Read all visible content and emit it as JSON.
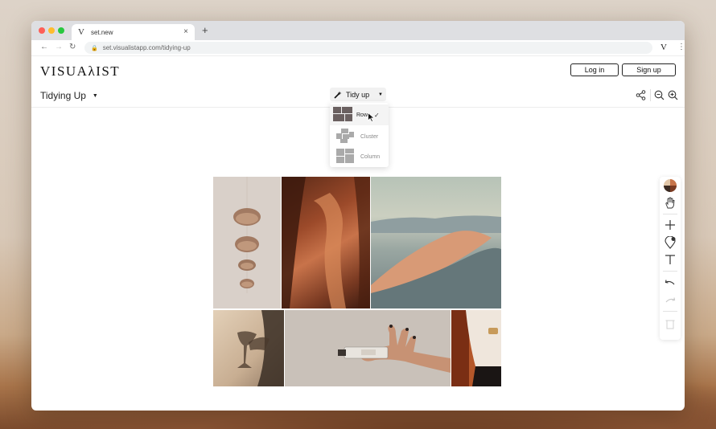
{
  "browser": {
    "tab_title": "set.new",
    "tab_favicon": "V",
    "tab_close": "×",
    "new_tab": "+",
    "url": "set.visualistapp.com/tidying-up",
    "extension_letter": "V",
    "menu": "⋮"
  },
  "header": {
    "logo": "VISUAλIST",
    "login_label": "Log in",
    "signup_label": "Sign up"
  },
  "toolbar": {
    "board_title": "Tidying Up",
    "board_caret": "▼",
    "tidy_label": "Tidy up",
    "tidy_caret": "▼"
  },
  "tidy_menu": {
    "options": [
      {
        "label": "Row",
        "selected": true,
        "check": "✓"
      },
      {
        "label": "Cluster",
        "selected": false
      },
      {
        "label": "Column",
        "selected": false
      }
    ]
  },
  "canvas_images": [
    "seashells-photo",
    "sandstone-canyon-photo",
    "desert-dunes-photo",
    "champagne-glass-shadow-photo",
    "hand-holding-perfume-photo",
    "person-in-blazer-photo"
  ],
  "icons": {
    "share": "share-icon",
    "zoom_out": "zoom-out-icon",
    "zoom_in": "zoom-in-icon",
    "right_tools": [
      "color-palette-icon",
      "hand-icon",
      "plus-icon",
      "pin-icon",
      "text-icon",
      "undo-icon",
      "redo-icon",
      "trash-icon"
    ]
  },
  "colors": {
    "accent_dark": "#222222",
    "option_thumb_selected": "#6a6060",
    "option_thumb": "#aaaaaa"
  }
}
